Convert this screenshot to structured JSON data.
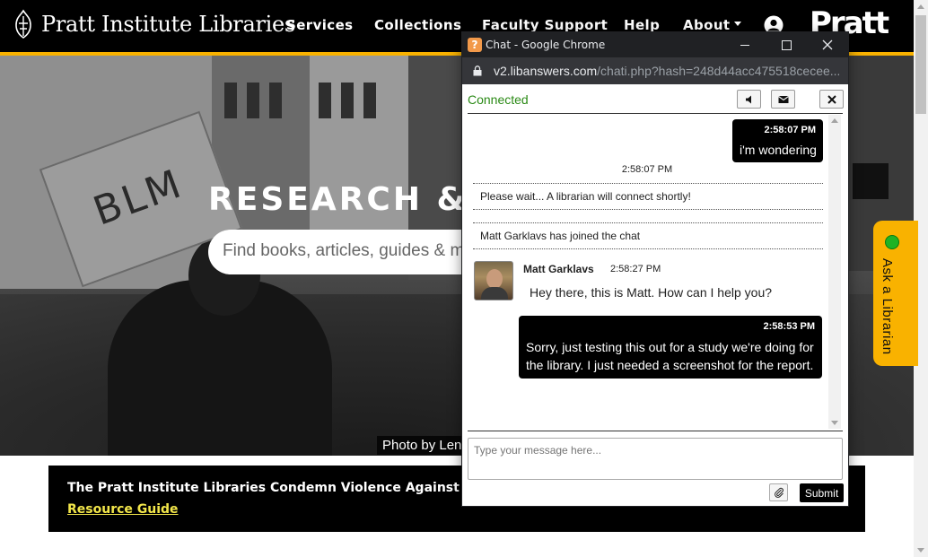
{
  "site": {
    "logo_text": "Pratt Institute Libraries",
    "nav": {
      "services": "Services",
      "collections": "Collections",
      "faculty": "Faculty Support",
      "help": "Help",
      "about": "About"
    },
    "brand": "Pratt"
  },
  "hero": {
    "title": "RESEARCH & L",
    "search_placeholder": "Find books, articles, guides & m",
    "sign_text": "BLM",
    "photo_credit": "Photo by Len"
  },
  "banner": {
    "text": "The Pratt Institute Libraries Condemn Violence Against Black",
    "link": "Resource Guide"
  },
  "ask_tab": {
    "label": "Ask a Librarian",
    "status_color": "#1fb324"
  },
  "chat": {
    "window_title": "Chat - Google Chrome",
    "url_host": "v2.libanswers.com",
    "url_path": "/chati.php?hash=248d44acc475518cecee...",
    "status": "Connected",
    "messages": [
      {
        "type": "patron",
        "time": "2:58:07 PM",
        "text": "i'm wondering"
      },
      {
        "type": "system_time",
        "time": "2:58:07 PM"
      },
      {
        "type": "system",
        "text": "Please wait... A librarian will connect shortly!"
      },
      {
        "type": "system",
        "text": "Matt Garklavs has joined the chat"
      },
      {
        "type": "agent",
        "name": "Matt Garklavs",
        "time": "2:58:27 PM",
        "text": "Hey there, this is Matt. How can I help you?"
      },
      {
        "type": "patron",
        "time": "2:58:53 PM",
        "text": "Sorry, just testing this out for a study we're doing for the library. I just needed a screenshot for the report."
      }
    ],
    "input_placeholder": "Type your message here...",
    "submit_label": "Submit"
  },
  "colors": {
    "accent": "#f9b200",
    "connected": "#2b8a16",
    "link": "#f2e64a"
  }
}
